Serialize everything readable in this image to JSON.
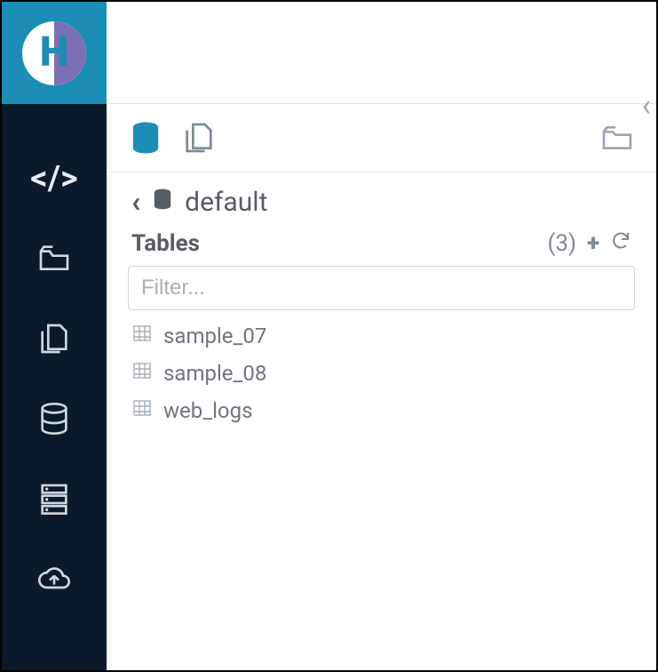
{
  "sidebar": {
    "items": [
      {
        "name": "editor",
        "icon": "code"
      },
      {
        "name": "documents",
        "icon": "folder-open"
      },
      {
        "name": "files",
        "icon": "files"
      },
      {
        "name": "databases",
        "icon": "database"
      },
      {
        "name": "servers",
        "icon": "server"
      },
      {
        "name": "upload",
        "icon": "cloud-upload"
      }
    ]
  },
  "toolbar": {
    "tab_db": "databases",
    "tab_files": "files",
    "folder_action": "open-folder"
  },
  "breadcrumb": {
    "database": "default"
  },
  "tables_section": {
    "title": "Tables",
    "count": "(3)",
    "filter_placeholder": "Filter...",
    "items": [
      {
        "name": "sample_07"
      },
      {
        "name": "sample_08"
      },
      {
        "name": "web_logs"
      }
    ]
  }
}
